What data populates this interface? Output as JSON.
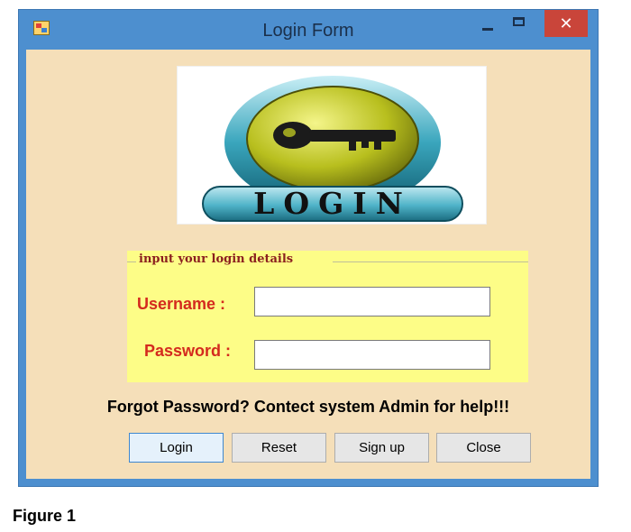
{
  "window": {
    "title": "Login Form",
    "close_glyph": "✕",
    "icons": {
      "app": "app-icon",
      "minimize": "minimize-icon",
      "maximize": "maximize-icon",
      "close": "close-icon"
    }
  },
  "logo": {
    "text": "LOGIN",
    "icon": "key-icon"
  },
  "form": {
    "group_title": "input your login details",
    "username_label": "Username :",
    "password_label": "Password :",
    "username_value": "",
    "password_value": ""
  },
  "help_text": "Forgot Password? Contect system Admin for help!!!",
  "buttons": {
    "login": "Login",
    "reset": "Reset",
    "signup": "Sign up",
    "close": "Close"
  },
  "caption": "Figure 1",
  "colors": {
    "frame": "#4d8fcf",
    "client_bg": "#f5dfb9",
    "group_bg": "#fdfd87",
    "label_red": "#d42a1e",
    "close_red": "#c9453a"
  }
}
